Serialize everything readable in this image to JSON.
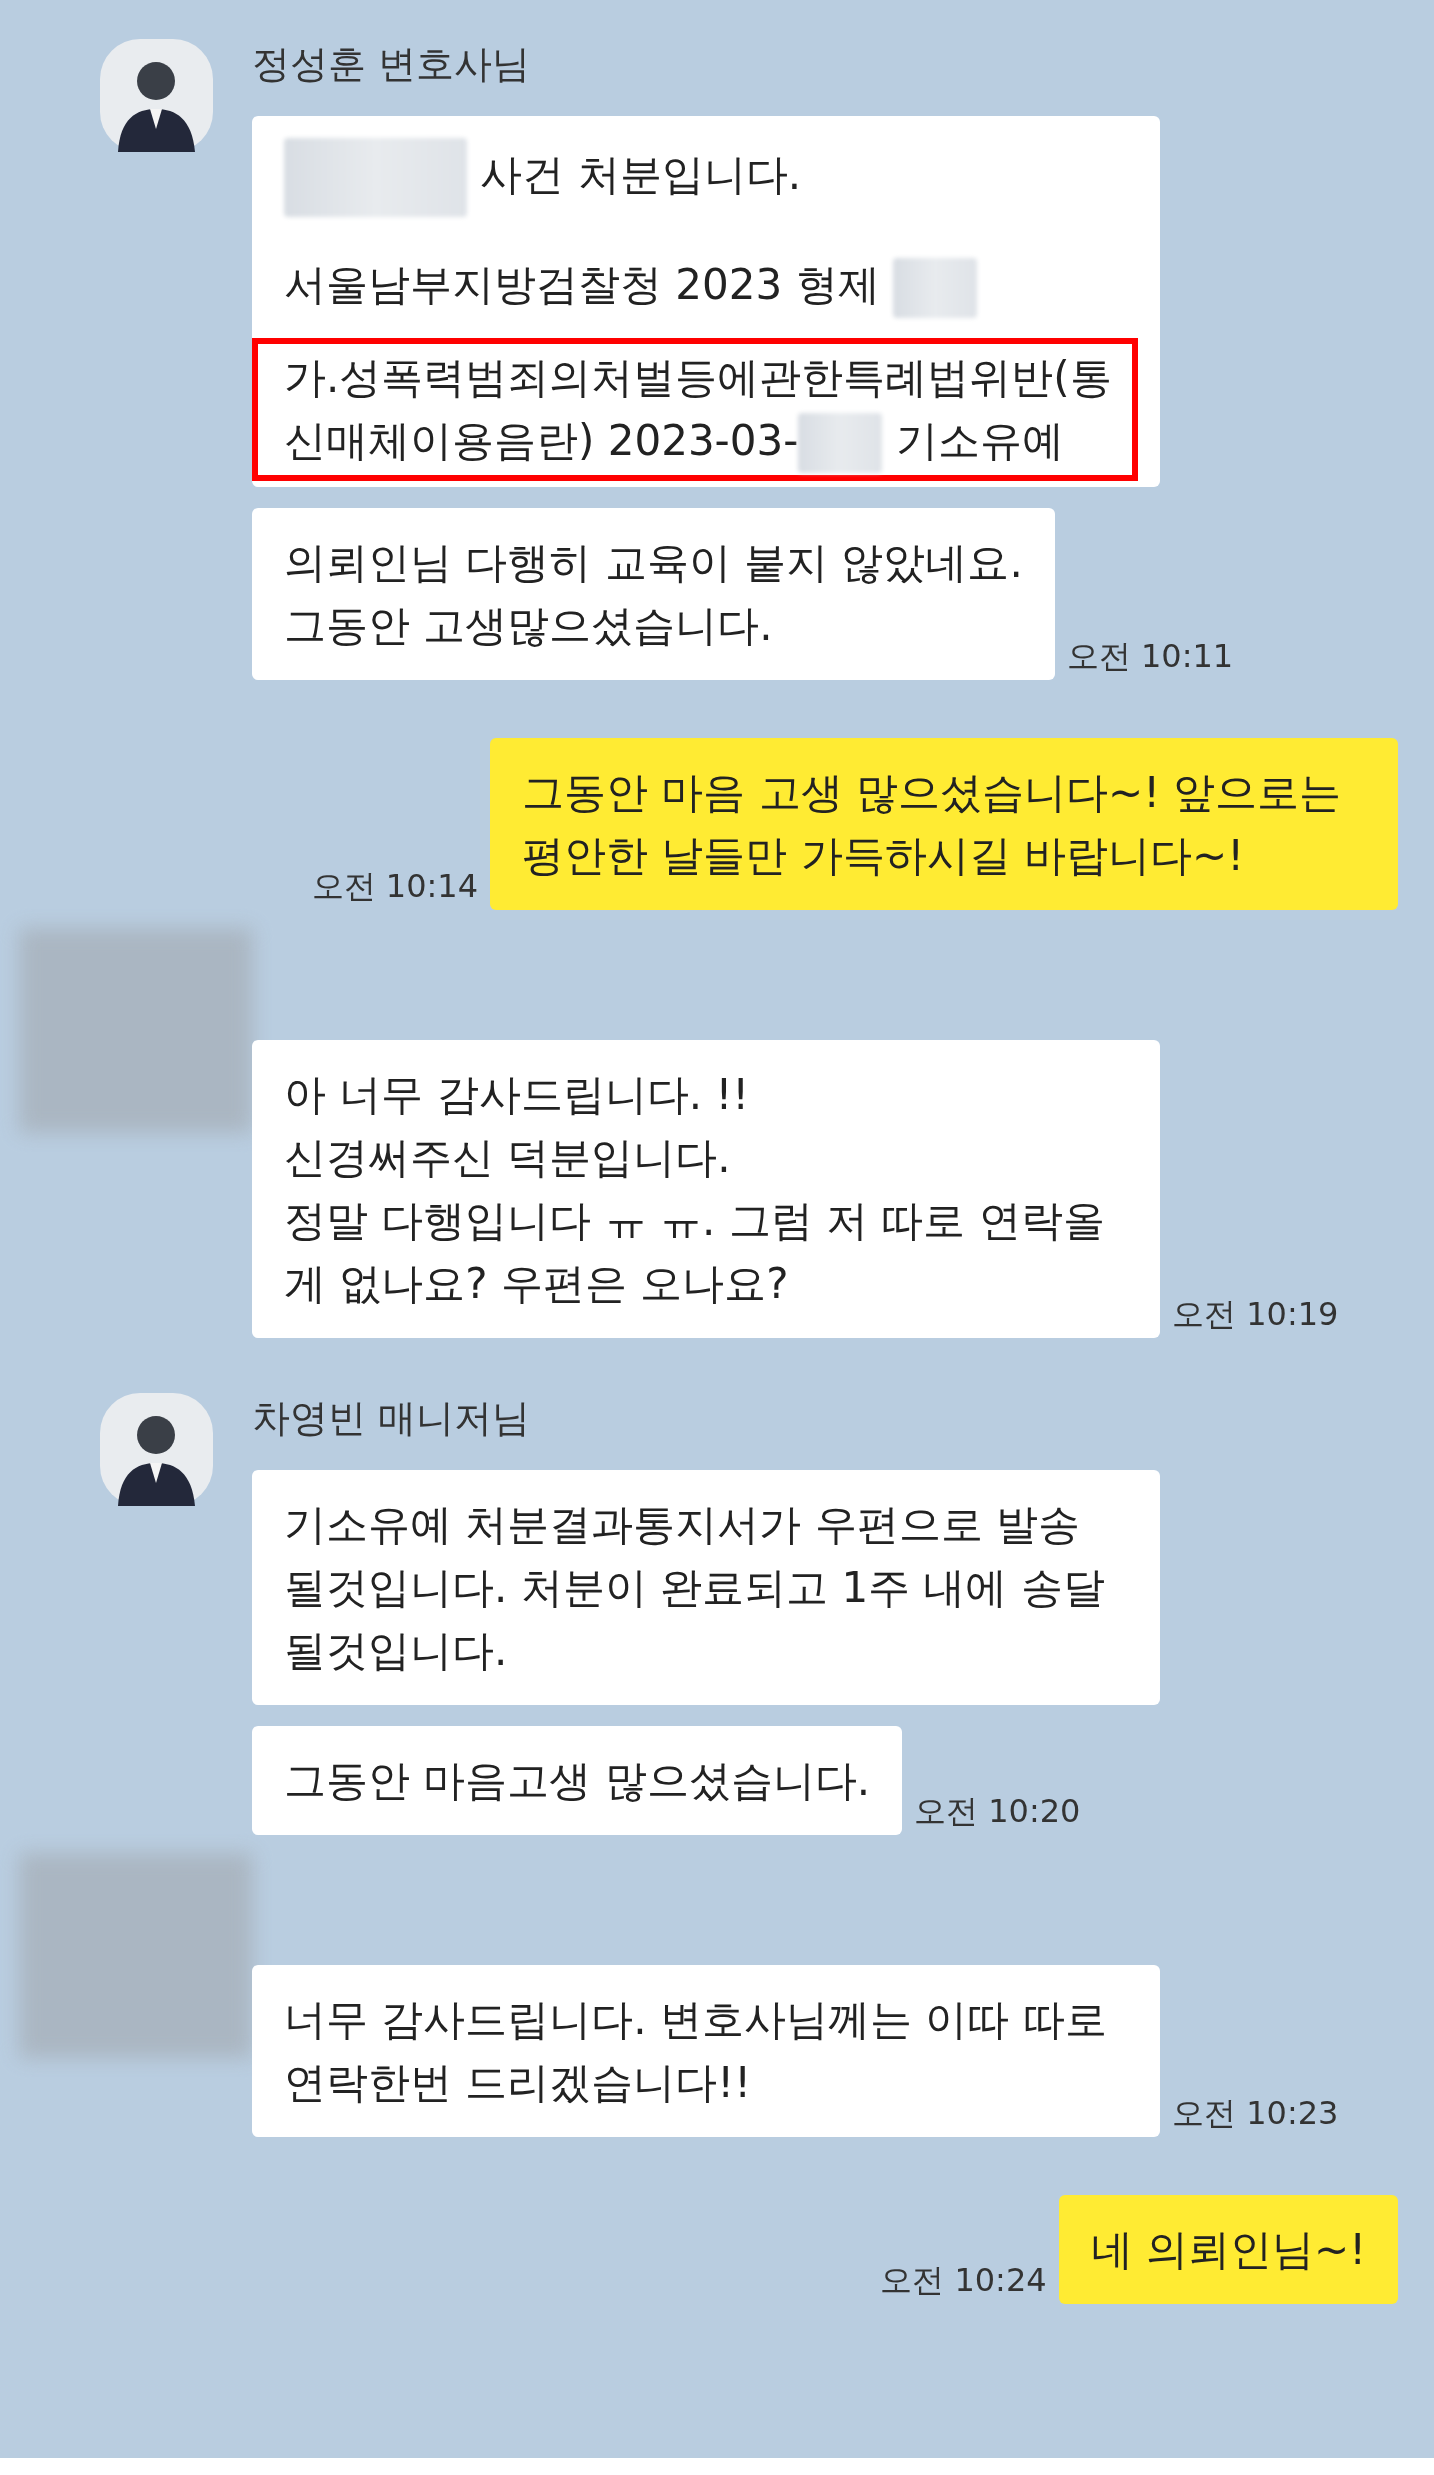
{
  "groups": [
    {
      "kind": "incoming",
      "avatar": {
        "kind": "photo"
      },
      "sender": "정성훈 변호사님",
      "time": "오전 10:11",
      "messages": [
        {
          "kind": "document",
          "paragraphs": [
            {
              "highlighted": false,
              "parts": [
                {
                  "kind": "block"
                },
                {
                  "kind": "text",
                  "text": " 사건 처분입니다."
                }
              ]
            },
            {
              "highlighted": false,
              "parts": [
                {
                  "kind": "text",
                  "text": "서울남부지방검찰청 2023 형제 "
                },
                {
                  "kind": "redacted"
                }
              ]
            },
            {
              "highlighted": true,
              "parts": [
                {
                  "kind": "text",
                  "text": "가.성폭력범죄의처벌등에관한특례법위반(통신매체이용음란)  2023-03-"
                },
                {
                  "kind": "redacted"
                },
                {
                  "kind": "text",
                  "text": " 기소유예"
                }
              ]
            }
          ]
        },
        {
          "kind": "text",
          "lines": [
            "의뢰인님 다행히 교육이 붙지 않았네요.",
            "그동안 고생많으셨습니다."
          ]
        }
      ]
    },
    {
      "kind": "outgoing",
      "time": "오전 10:14",
      "messages": [
        {
          "kind": "text",
          "lines": [
            "그동안 마음 고생 많으셨습니다~! 앞으로는 평안한 날들만 가득하시길 바랍니다~!"
          ]
        }
      ]
    },
    {
      "kind": "incoming",
      "avatar": {
        "kind": "blurred"
      },
      "time": "오전 10:19",
      "messages": [
        {
          "kind": "text",
          "lines": [
            "아 너무 감사드립니다. !!",
            "신경써주신 덕분입니다.",
            "정말 다행입니다 ㅠ ㅠ. 그럼 저 따로 연락올게 없나요? 우편은 오나요?"
          ]
        }
      ]
    },
    {
      "kind": "incoming",
      "avatar": {
        "kind": "photo"
      },
      "sender": "차영빈 매니저님",
      "time": "오전 10:20",
      "messages": [
        {
          "kind": "text",
          "lines": [
            "기소유예 처분결과통지서가 우편으로 발송 될것입니다. 처분이 완료되고 1주 내에 송달 될것입니다."
          ]
        },
        {
          "kind": "text",
          "lines": [
            "그동안 마음고생 많으셨습니다."
          ]
        }
      ]
    },
    {
      "kind": "incoming",
      "avatar": {
        "kind": "blurred"
      },
      "time": "오전 10:23",
      "messages": [
        {
          "kind": "text",
          "lines": [
            "너무 감사드립니다. 변호사님께는 이따 따로 연락한번 드리겠습니다!!"
          ]
        }
      ]
    },
    {
      "kind": "outgoing",
      "time": "오전 10:24",
      "messages": [
        {
          "kind": "text",
          "lines": [
            "네 의뢰인님~!"
          ]
        }
      ]
    }
  ]
}
